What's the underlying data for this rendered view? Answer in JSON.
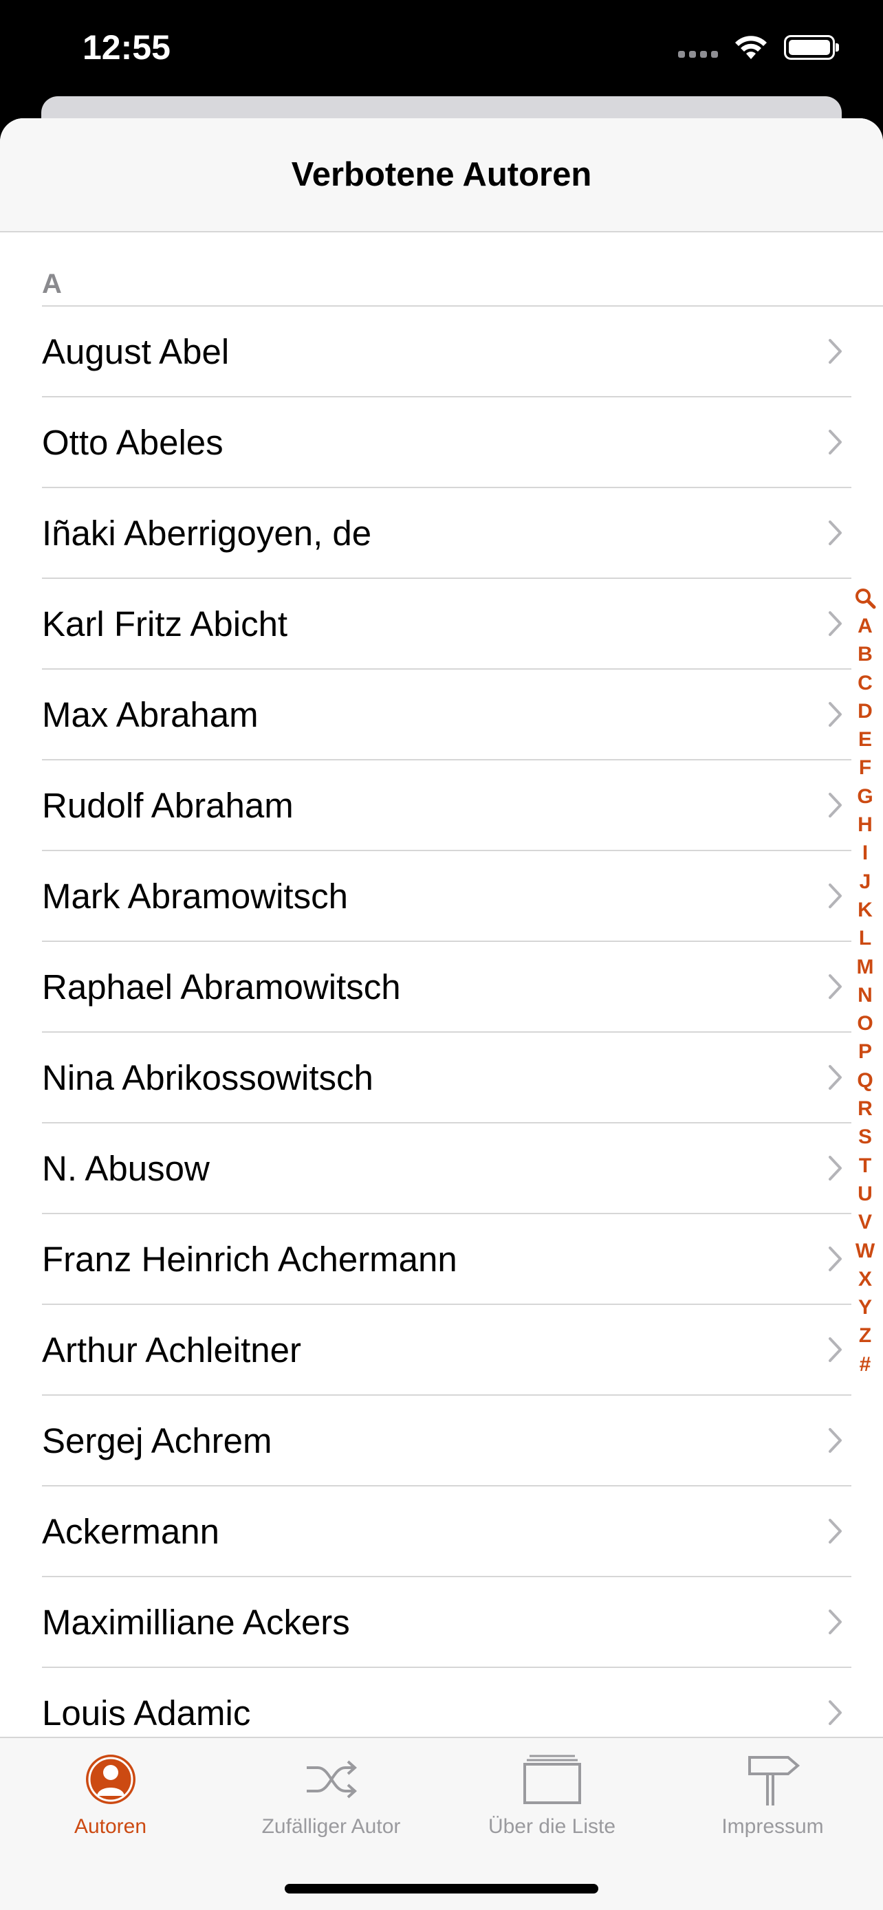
{
  "status": {
    "time": "12:55"
  },
  "nav": {
    "title": "Verbotene Autoren"
  },
  "section": {
    "letter": "A"
  },
  "authors": [
    "August Abel",
    "Otto Abeles",
    "Iñaki Aberrigoyen, de",
    "Karl Fritz Abicht",
    "Max Abraham",
    "Rudolf Abraham",
    "Mark Abramowitsch",
    "Raphael Abramowitsch",
    "Nina Abrikossowitsch",
    "N. Abusow",
    "Franz Heinrich Achermann",
    "Arthur Achleitner",
    "Sergej Achrem",
    "Ackermann",
    "Maximilliane Ackers",
    "Louis Adamic"
  ],
  "index_letters": [
    "A",
    "B",
    "C",
    "D",
    "E",
    "F",
    "G",
    "H",
    "I",
    "J",
    "K",
    "L",
    "M",
    "N",
    "O",
    "P",
    "Q",
    "R",
    "S",
    "T",
    "U",
    "V",
    "W",
    "X",
    "Y",
    "Z",
    "#"
  ],
  "tabs": [
    {
      "label": "Autoren",
      "icon": "person-icon",
      "active": true
    },
    {
      "label": "Zufälliger Autor",
      "icon": "shuffle-icon",
      "active": false
    },
    {
      "label": "Über die Liste",
      "icon": "stack-icon",
      "active": false
    },
    {
      "label": "Impressum",
      "icon": "signpost-icon",
      "active": false
    }
  ],
  "colors": {
    "accent": "#cc4a12",
    "inactive": "#9a9a9e"
  }
}
